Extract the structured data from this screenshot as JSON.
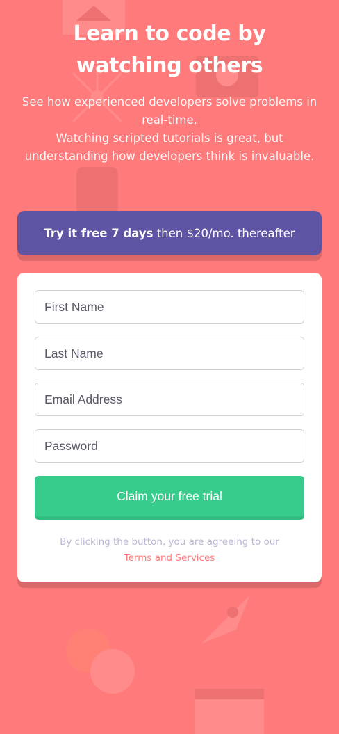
{
  "header": {
    "title": "Learn to code by watching others",
    "subtitle_line1": "See how experienced developers solve problems in real-time.",
    "subtitle_line2": "Watching scripted tutorials is great, but understanding how developers think is invaluable."
  },
  "offer": {
    "prefix": "Try it free 7 days",
    "suffix": "then $20/mo. thereafter"
  },
  "form": {
    "first_name_placeholder": "First Name",
    "last_name_placeholder": "Last Name",
    "email_placeholder": "Email Address",
    "password_placeholder": "Password",
    "submit_label": "Claim your free trial",
    "terms_text": "By clicking the button, you are agreeing to our",
    "terms_link": "Terms and Services"
  },
  "colors": {
    "background": "#ff7a7a",
    "offer_banner": "#5e54a4",
    "cta": "#38cc8c",
    "card": "#ffffff",
    "terms_text": "#bab7d4"
  }
}
